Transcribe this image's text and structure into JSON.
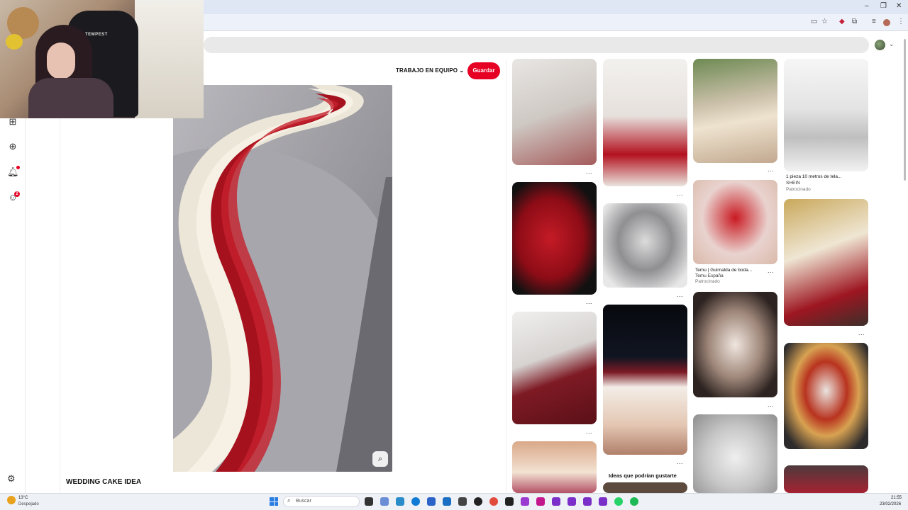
{
  "window": {
    "minimize": "–",
    "restore": "❐",
    "close": "✕"
  },
  "pin": {
    "team_label": "TRABAJO EN EQUIPO",
    "save_label": "Guardar",
    "title": "WEDDING CAKE IDEA"
  },
  "webcam": {
    "chair_brand": "TEMPEST"
  },
  "left_rail": {
    "icons": [
      "board-icon",
      "create-icon",
      "notifications-icon",
      "messages-icon",
      "settings-icon"
    ],
    "messages_badge": "2"
  },
  "grid": {
    "ads": [
      {
        "title": "1 pieza 10 metros de tela...",
        "brand": "SHEIN",
        "sponsored": "Patrocinado"
      },
      {
        "title": "Temu | Guirnalda de boda...",
        "brand": "Temu España",
        "sponsored": "Patrocinado"
      }
    ],
    "more_label": "...",
    "ideas_label": "Ideas que podrían gustarte"
  },
  "taskbar": {
    "weather_temp": "13°C",
    "weather_desc": "Despejado",
    "search_placeholder": "Buscar",
    "time": "21:55",
    "date": "23/02/2026"
  },
  "colors": {
    "accent": "#e60023",
    "search_bg": "#e9e9e9",
    "titlebar": "#dfe6f4"
  }
}
